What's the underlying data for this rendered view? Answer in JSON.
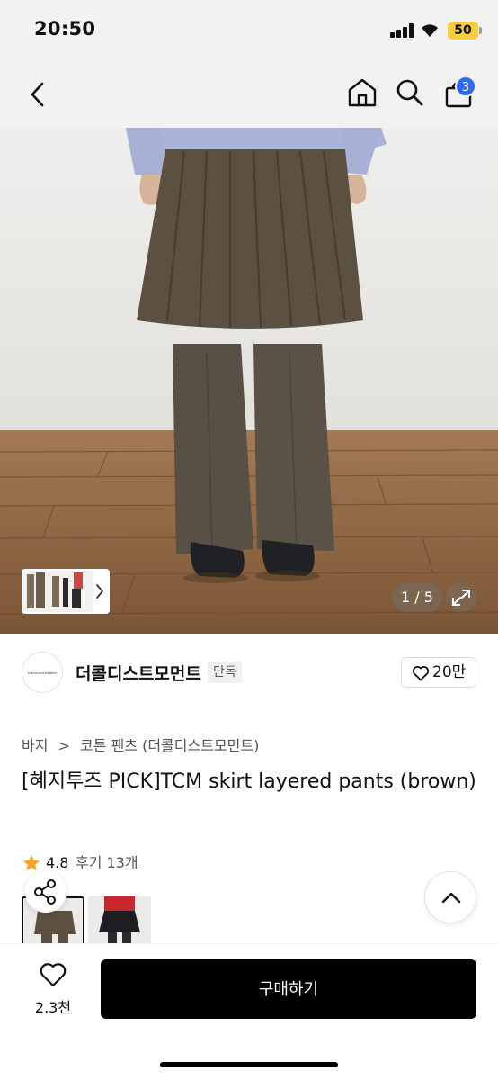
{
  "status_bar": {
    "time": "20:50",
    "battery": "50"
  },
  "nav": {
    "cart_count": "3"
  },
  "gallery": {
    "page_indicator": "1 / 5"
  },
  "store": {
    "logo_text": "THECOLDISTMOMENT",
    "name": "더콜디스트모먼트",
    "badge": "단독",
    "likes": "20만"
  },
  "breadcrumb": {
    "category": "바지",
    "separator": ">",
    "subcategory": "코튼 팬츠 (더콜디스트모먼트)"
  },
  "product": {
    "title": "[혜지투즈 PICK]TCM skirt layered pants (brown)"
  },
  "rating": {
    "value": "4.8",
    "reviews": "후기 13개"
  },
  "bottom_bar": {
    "wish_count": "2.3천",
    "buy_label": "구매하기"
  },
  "colors": {
    "accent": "#2f6af2",
    "star": "#f5a623",
    "buy_button": "#000000"
  }
}
